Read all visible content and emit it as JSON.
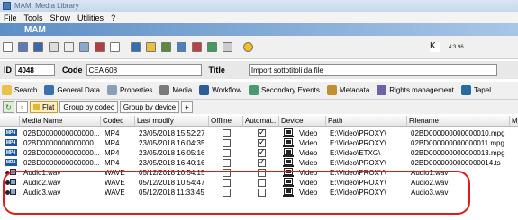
{
  "window": {
    "title": "MAM, Media Library"
  },
  "menu": [
    "File",
    "Tools",
    "Show",
    "Utilities",
    "?"
  ],
  "banner": {
    "title": "MAM"
  },
  "toolbar": {
    "zoom_label": "4:3\n96"
  },
  "record": {
    "id_label": "ID",
    "id_value": "4048",
    "code_label": "Code",
    "code_value": "CEA 608",
    "title_label": "Title",
    "title_value": "Import sottotitoli da file"
  },
  "tabs": [
    "Search",
    "General Data",
    "Properties",
    "Media",
    "Workflow",
    "Secondary Events",
    "Metadata",
    "Rights management",
    "Tapel"
  ],
  "grouping": {
    "flat": "Flat",
    "by_codec": "Group by codec",
    "by_device": "Group by device",
    "add": "+"
  },
  "columns": [
    "Media Name",
    "Codec",
    "Last modify",
    "Offline",
    "Automat...",
    "Device",
    "Path",
    "Filename",
    "M"
  ],
  "rows": [
    {
      "type": "MP4",
      "media_name": "02BD0000000000000...",
      "codec": "MP4",
      "last_modify": "23/05/2018 15:52:27",
      "offline": false,
      "automatic": true,
      "device": "Video",
      "path": "E:\\Video\\PROXY\\",
      "filename": "02BD000000000000010.mpg"
    },
    {
      "type": "MP4",
      "media_name": "02BD0000000000000...",
      "codec": "MP4",
      "last_modify": "23/05/2018 16:04:35",
      "offline": false,
      "automatic": true,
      "device": "Video",
      "path": "E:\\Video\\PROXY\\",
      "filename": "02BD000000000000011.mpg"
    },
    {
      "type": "MP4",
      "media_name": "02BD0000000000000...",
      "codec": "MP4",
      "last_modify": "23/05/2018 16:05:16",
      "offline": false,
      "automatic": true,
      "device": "Video",
      "path": "E:\\Video\\ETXG\\",
      "filename": "02BD000000000000013.mpg"
    },
    {
      "type": "MP4",
      "media_name": "02BD0000000000000...",
      "codec": "MP4",
      "last_modify": "23/05/2018 16:40:16",
      "offline": false,
      "automatic": true,
      "device": "Video",
      "path": "E:\\Video\\PROXY\\",
      "filename": "02BD0000000000000014.ts"
    },
    {
      "type": "audio",
      "media_name": "Audio1.wav",
      "codec": "WAVE",
      "last_modify": "05/12/2018 10:54:15",
      "offline": false,
      "automatic": false,
      "device": "Video",
      "path": "E:\\Video\\PROXY\\",
      "filename": "Audio1.wav"
    },
    {
      "type": "audio",
      "media_name": "Audio2.wav",
      "codec": "WAVE",
      "last_modify": "05/12/2018 10:54:47",
      "offline": false,
      "automatic": false,
      "device": "Video",
      "path": "E:\\Video\\PROXY\\",
      "filename": "Audio2.wav"
    },
    {
      "type": "audio",
      "media_name": "Audio3.wav",
      "codec": "WAVE",
      "last_modify": "05/12/2018 11:33:45",
      "offline": false,
      "automatic": false,
      "device": "Video",
      "path": "E:\\Video\\PROXY\\",
      "filename": "Audio3.wav"
    }
  ],
  "colors": {
    "banner": "#5d8ec5",
    "selection_highlight": "#e01a1a",
    "media_badge": "#1f57a0"
  }
}
